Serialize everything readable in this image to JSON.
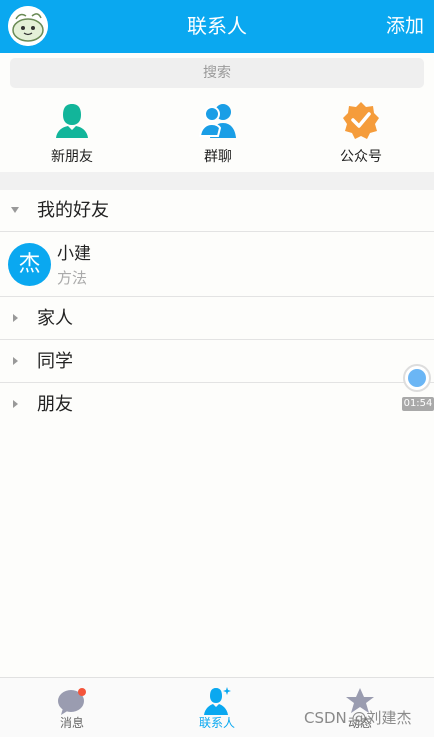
{
  "header": {
    "title": "联系人",
    "action": "添加"
  },
  "search": {
    "placeholder": "搜索"
  },
  "quick": [
    {
      "label": "新朋友",
      "icon": "new-friend-icon",
      "color": "#12b59a"
    },
    {
      "label": "群聊",
      "icon": "group-chat-icon",
      "color": "#1a9ee6"
    },
    {
      "label": "公众号",
      "icon": "official-account-icon",
      "color": "#f59c3b"
    }
  ],
  "groups": [
    {
      "name": "我的好友",
      "expanded": true
    },
    {
      "name": "家人",
      "expanded": false
    },
    {
      "name": "同学",
      "expanded": false
    },
    {
      "name": "朋友",
      "expanded": false
    }
  ],
  "contact": {
    "avatar_text": "杰",
    "name": "小建",
    "status": "方法"
  },
  "floating": {
    "time": "01:54"
  },
  "nav": [
    {
      "label": "消息",
      "icon": "message-icon",
      "active": false
    },
    {
      "label": "联系人",
      "icon": "contacts-icon",
      "active": true
    },
    {
      "label": "动态",
      "icon": "star-icon",
      "active": false
    }
  ],
  "watermark": "CSDN @刘建杰",
  "colors": {
    "primary": "#0aa8f0",
    "text": "#222222",
    "muted": "#aaaaaa"
  }
}
